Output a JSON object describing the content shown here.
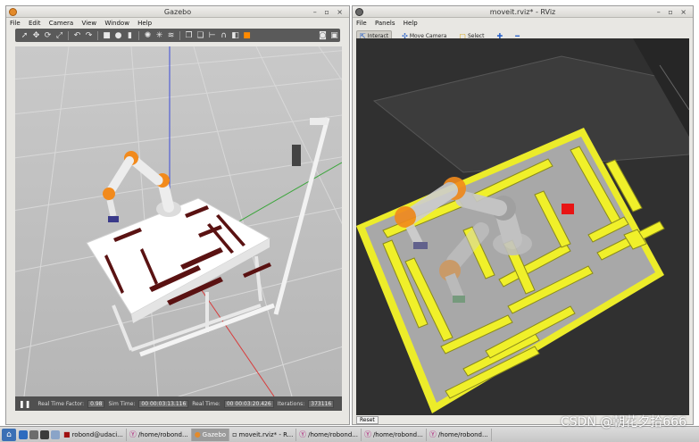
{
  "gazebo": {
    "title": "Gazebo",
    "window_controls": "– ▫ ×",
    "menu": [
      "File",
      "Edit",
      "Camera",
      "View",
      "Window",
      "Help"
    ],
    "toolbar_icons": [
      "select-arrow-icon",
      "translate-icon",
      "rotate-icon",
      "scale-icon",
      "undo-icon",
      "redo-icon",
      "box-icon",
      "sphere-icon",
      "cylinder-icon",
      "point-light-icon",
      "spot-light-icon",
      "directional-light-icon",
      "copy-icon",
      "paste-icon",
      "align-icon",
      "snap-icon",
      "change-view-icon",
      "screenshot-icon",
      "record-icon"
    ],
    "status": {
      "pause_icon": "pause-icon",
      "real_time_factor_label": "Real Time Factor:",
      "real_time_factor": "0.98",
      "sim_time_label": "Sim Time:",
      "sim_time": "00 00:03:13.116",
      "real_time_label": "Real Time:",
      "real_time": "00 00:03:20.426",
      "iterations_label": "Iterations:",
      "iterations": "373116"
    }
  },
  "rviz": {
    "title": "moveit.rviz* - RViz",
    "window_controls": "– ▫ ×",
    "menu": [
      "File",
      "Panels",
      "Help"
    ],
    "tools": [
      {
        "label": "Interact",
        "icon": "interact-icon"
      },
      {
        "label": "Move Camera",
        "icon": "camera-icon"
      },
      {
        "label": "Select",
        "icon": "select-icon"
      },
      {
        "label": "",
        "icon": "add-tool-icon"
      },
      {
        "label": "",
        "icon": "remove-tool-icon"
      }
    ],
    "reset_label": "Reset"
  },
  "taskbar": {
    "tasks": [
      {
        "label": "robond@udaci...",
        "icon": "terminal-icon"
      },
      {
        "label": "/home/robond...",
        "icon": "folder-icon"
      },
      {
        "label": "Gazebo",
        "icon": "gazebo-icon"
      },
      {
        "label": "moveit.rviz* - R...",
        "icon": "rviz-icon"
      },
      {
        "label": "/home/robond...",
        "icon": "folder-icon"
      },
      {
        "label": "/home/robond...",
        "icon": "folder-icon"
      },
      {
        "label": "/home/robond...",
        "icon": "folder-icon"
      }
    ]
  },
  "watermark": "CSDN @朝花夕拾666"
}
